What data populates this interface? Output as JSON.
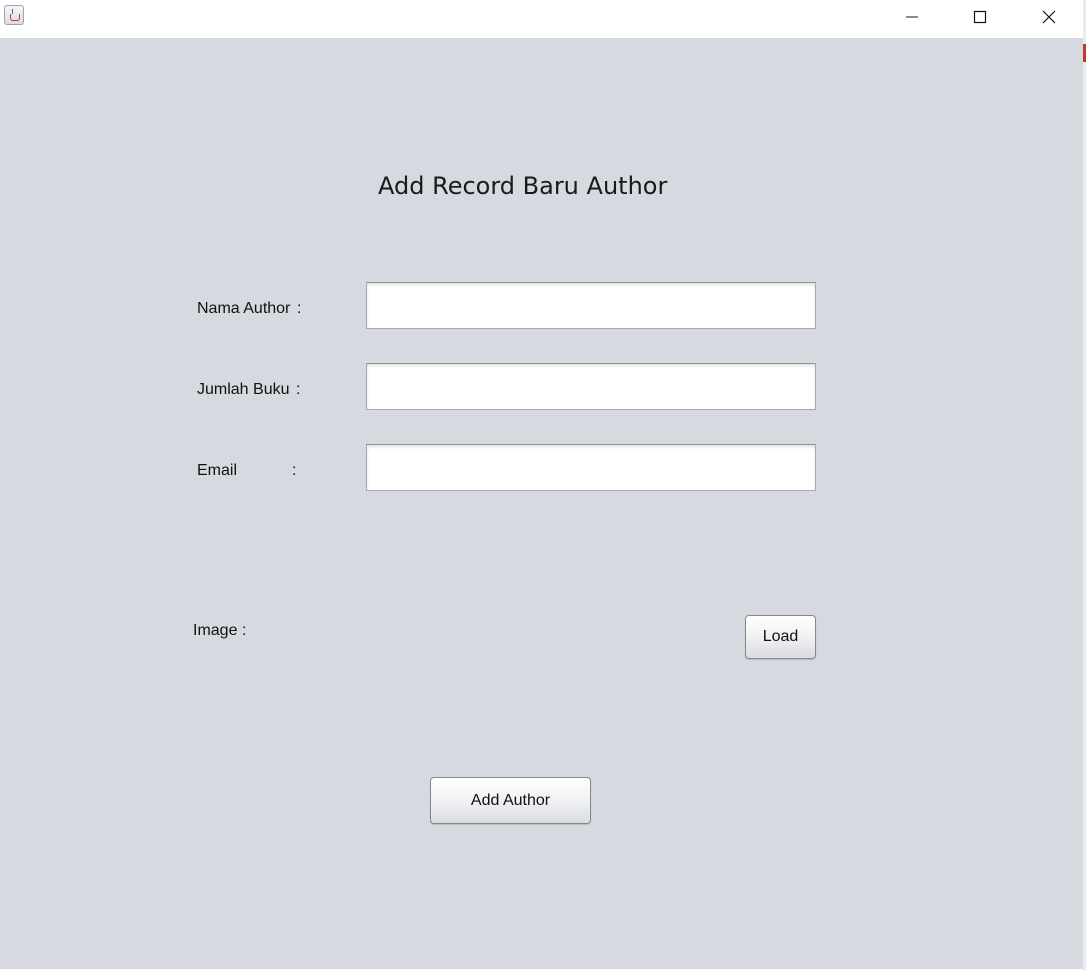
{
  "window": {
    "title": "",
    "app_icon": "java-coffee-cup-icon",
    "controls": [
      {
        "name": "minimize-icon"
      },
      {
        "name": "maximize-icon"
      },
      {
        "name": "close-icon"
      }
    ]
  },
  "form": {
    "heading": "Add Record Baru Author",
    "fields": [
      {
        "label": "Nama Author",
        "colon": ":",
        "value": ""
      },
      {
        "label": "Jumlah Buku",
        "colon": ":",
        "value": ""
      },
      {
        "label": "Email",
        "colon": ":",
        "value": ""
      }
    ],
    "image": {
      "label": "Image",
      "colon": ":",
      "load_label": "Load"
    },
    "submit_label": "Add Author"
  },
  "colors": {
    "background": "#d6d9e0",
    "titlebar": "#ffffff",
    "field": "#ffffff"
  }
}
